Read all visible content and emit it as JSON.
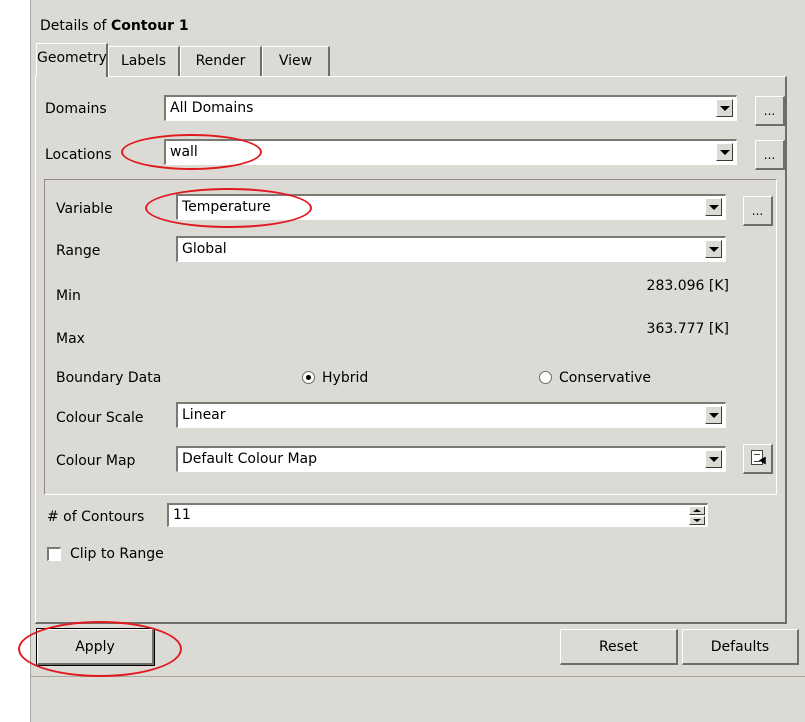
{
  "header": {
    "title_prefix": "Details of ",
    "title_name": "Contour 1"
  },
  "tabs": [
    {
      "label": "Geometry",
      "active": true
    },
    {
      "label": "Labels",
      "active": false
    },
    {
      "label": "Render",
      "active": false
    },
    {
      "label": "View",
      "active": false
    }
  ],
  "geometry": {
    "domains": {
      "label": "Domains",
      "value": "All Domains"
    },
    "locations": {
      "label": "Locations",
      "value": "wall"
    },
    "browse_label": "...",
    "variable": {
      "label": "Variable",
      "value": "Temperature"
    },
    "range": {
      "label": "Range",
      "value": "Global"
    },
    "min": {
      "label": "Min",
      "value": "283.096 [K]"
    },
    "max": {
      "label": "Max",
      "value": "363.777 [K]"
    },
    "boundary_data": {
      "label": "Boundary Data",
      "options": [
        {
          "label": "Hybrid",
          "selected": true
        },
        {
          "label": "Conservative",
          "selected": false
        }
      ]
    },
    "colour_scale": {
      "label": "Colour Scale",
      "value": "Linear"
    },
    "colour_map": {
      "label": "Colour Map",
      "value": "Default Colour Map",
      "edit_icon": "edit-colour-map-icon"
    },
    "contours": {
      "label": "# of Contours",
      "value": "11"
    },
    "clip_to_range": {
      "label": "Clip to Range",
      "checked": false
    }
  },
  "actions": {
    "apply": "Apply",
    "reset": "Reset",
    "defaults": "Defaults"
  },
  "colors": {
    "annotation": "#e0191f",
    "panel": "#dcdad5"
  }
}
